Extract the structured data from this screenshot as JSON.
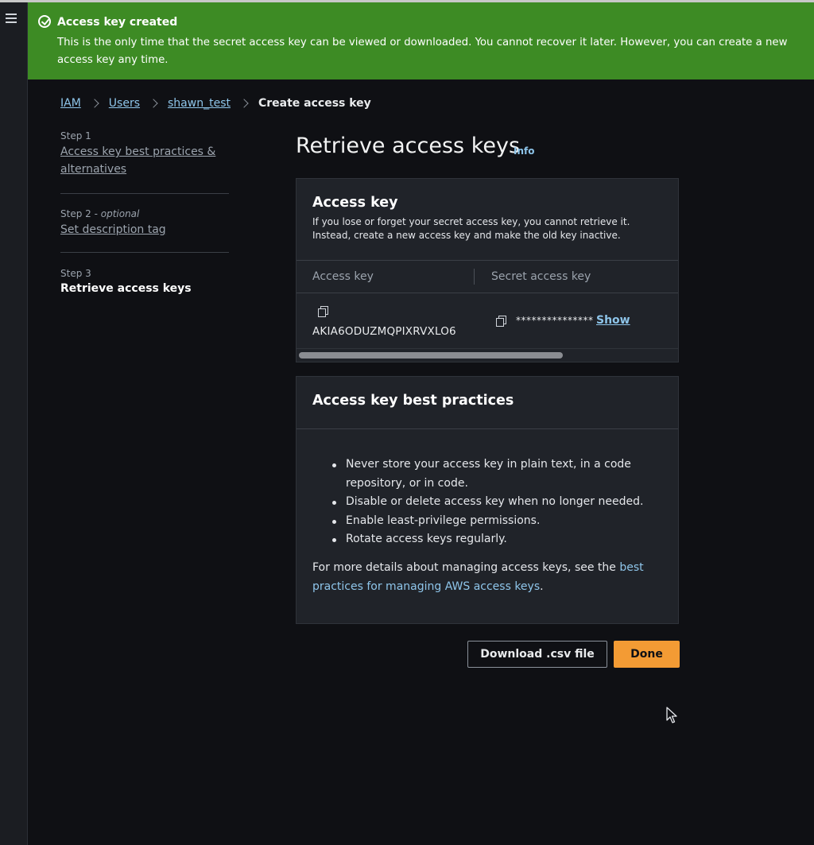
{
  "flash": {
    "title": "Access key created",
    "message": "This is the only time that the secret access key can be viewed or downloaded. You cannot recover it later. However, you can create a new access key any time.",
    "color": "#3d8b24"
  },
  "breadcrumb": {
    "items": [
      "IAM",
      "Users",
      "shawn_test"
    ],
    "current": "Create access key"
  },
  "steps": [
    {
      "label": "Step 1",
      "optional": "",
      "name": "Access key best practices & alternatives"
    },
    {
      "label": "Step 2 - ",
      "optional": "optional",
      "name": "Set description tag"
    },
    {
      "label": "Step 3",
      "optional": "",
      "name": "Retrieve access keys"
    }
  ],
  "page": {
    "title": "Retrieve access keys",
    "info": "Info"
  },
  "access_key_panel": {
    "title": "Access key",
    "description": "If you lose or forget your secret access key, you cannot retrieve it. Instead, create a new access key and make the old key inactive.",
    "columns": [
      "Access key",
      "Secret access key"
    ],
    "access_key_value": "AKIA6ODUZMQPIXRVXLO6",
    "secret_masked": "***************",
    "show_label": "Show"
  },
  "best_practices_panel": {
    "title": "Access key best practices",
    "items": [
      "Never store your access key in plain text, in a code repository, or in code.",
      "Disable or delete access key when no longer needed.",
      "Enable least-privilege permissions.",
      "Rotate access keys regularly."
    ],
    "more_prefix": "For more details about managing access keys, see the ",
    "more_link": "best practices for managing AWS access keys",
    "more_suffix": "."
  },
  "buttons": {
    "download": "Download .csv file",
    "done": "Done"
  },
  "colors": {
    "accent_link": "#8ec5ea",
    "primary_button": "#f39b34",
    "background": "#0f1014",
    "panel": "#202329"
  },
  "icons": [
    "menu-icon",
    "success-check-icon",
    "chevron-right-icon",
    "copy-icon",
    "mouse-cursor-icon"
  ]
}
